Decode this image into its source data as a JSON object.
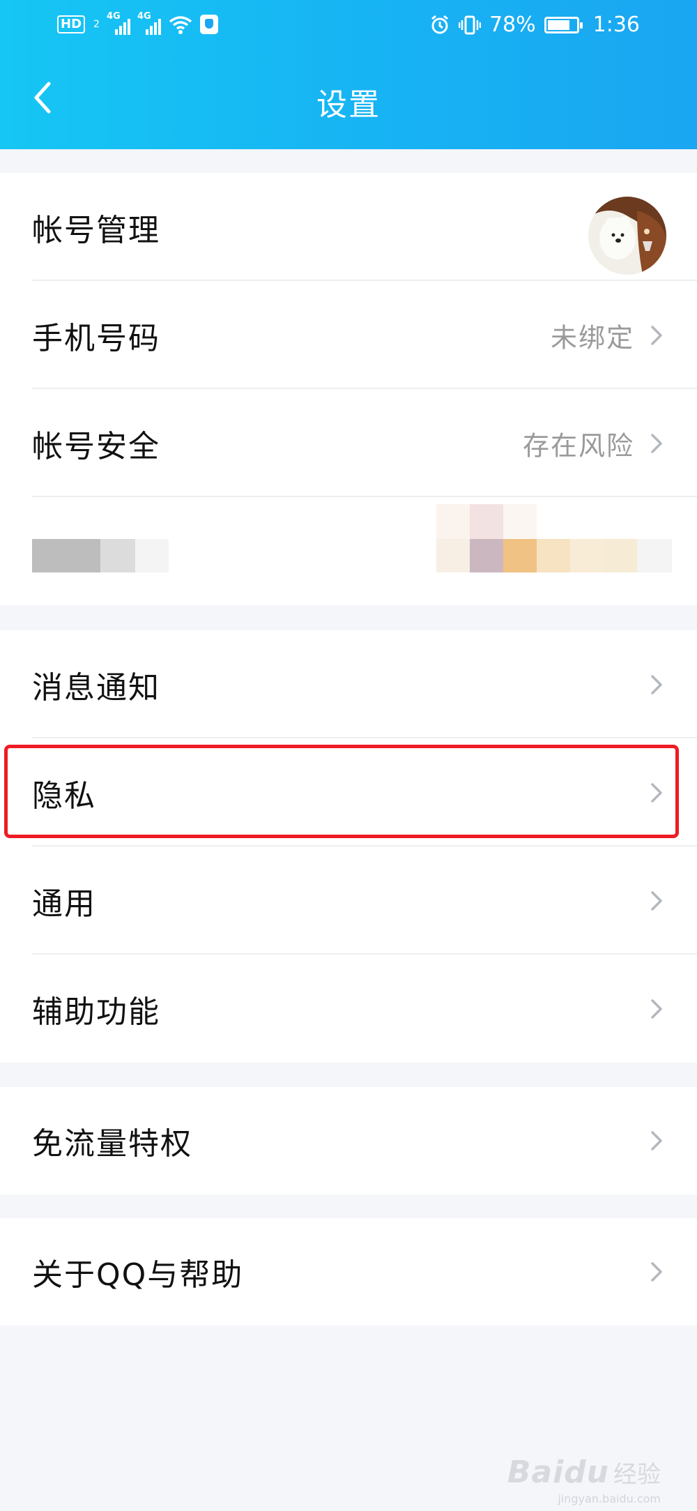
{
  "status_bar": {
    "hd": "HD",
    "sim": "2",
    "net1": "4G",
    "net2": "4G",
    "battery_percent": "78%",
    "battery_level": 0.78,
    "time": "1:36"
  },
  "header": {
    "title": "设置"
  },
  "settings": {
    "account_manage": "帐号管理",
    "phone": {
      "label": "手机号码",
      "value": "未绑定"
    },
    "account_security": {
      "label": "帐号安全",
      "value": "存在风险"
    },
    "notifications": "消息通知",
    "privacy": "隐私",
    "general": "通用",
    "accessibility": "辅助功能",
    "free_data": "免流量特权",
    "about": "关于QQ与帮助"
  },
  "colors": {
    "header_gradient_start": "#16c6f4",
    "header_gradient_end": "#1aa6f2",
    "highlight_border": "#ee1b24",
    "page_background": "#f5f6fa"
  },
  "icons": [
    "back-chevron-icon",
    "chevron-right-icon",
    "alarm-icon",
    "vibrate-icon",
    "wifi-icon",
    "shield-icon",
    "battery-icon"
  ],
  "watermark": {
    "brand": "Baidu",
    "suffix": "经验",
    "url": "jingyan.baidu.com"
  }
}
